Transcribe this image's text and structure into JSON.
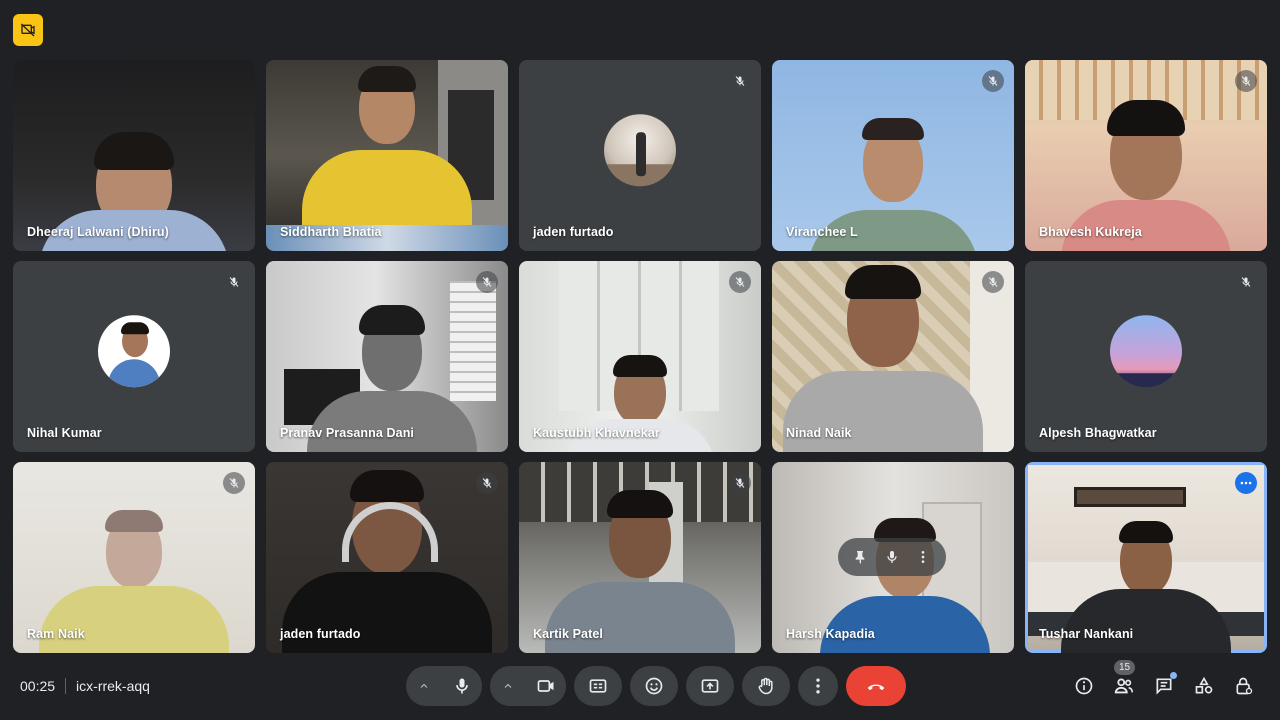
{
  "meeting": {
    "time": "00:25",
    "code": "icx-rrek-aqq",
    "participant_count": "15"
  },
  "participants": [
    {
      "name": "Dheeraj Lalwani (Dhiru)",
      "muted": false,
      "camera": true
    },
    {
      "name": "Siddharth Bhatia",
      "muted": false,
      "camera": true
    },
    {
      "name": "jaden furtado",
      "muted": true,
      "camera": false
    },
    {
      "name": "Viranchee L",
      "muted": true,
      "camera": true
    },
    {
      "name": "Bhavesh Kukreja",
      "muted": true,
      "camera": true
    },
    {
      "name": "Nihal Kumar",
      "muted": true,
      "camera": false
    },
    {
      "name": "Pranav Prasanna Dani",
      "muted": true,
      "camera": true
    },
    {
      "name": "Kaustubh Khavnekar",
      "muted": true,
      "camera": true
    },
    {
      "name": "Ninad Naik",
      "muted": true,
      "camera": true
    },
    {
      "name": "Alpesh Bhagwatkar",
      "muted": true,
      "camera": false
    },
    {
      "name": "Ram Naik",
      "muted": true,
      "camera": true
    },
    {
      "name": "jaden furtado",
      "muted": true,
      "camera": true
    },
    {
      "name": "Kartik Patel",
      "muted": true,
      "camera": true
    },
    {
      "name": "Harsh Kapadia",
      "muted": false,
      "camera": true
    },
    {
      "name": "Tushar Nankani",
      "muted": false,
      "camera": true
    }
  ],
  "icons": {
    "recording": "recording-off-icon",
    "mic": "mic-icon",
    "camera": "videocam-icon",
    "captions": "closed-caption-icon",
    "emoji": "emoji-icon",
    "present": "present-screen-icon",
    "raise_hand": "hand-icon",
    "more": "more-vert-icon",
    "hangup": "call-end-icon",
    "info": "info-icon",
    "people": "people-icon",
    "chat": "chat-icon",
    "activities": "activities-icon",
    "host_controls": "lock-person-icon"
  },
  "colors": {
    "background": "#202124",
    "tile": "#3c4043",
    "hangup": "#ea4335",
    "active_border": "#8ab4f8",
    "recording_badge": "#f9c413"
  }
}
